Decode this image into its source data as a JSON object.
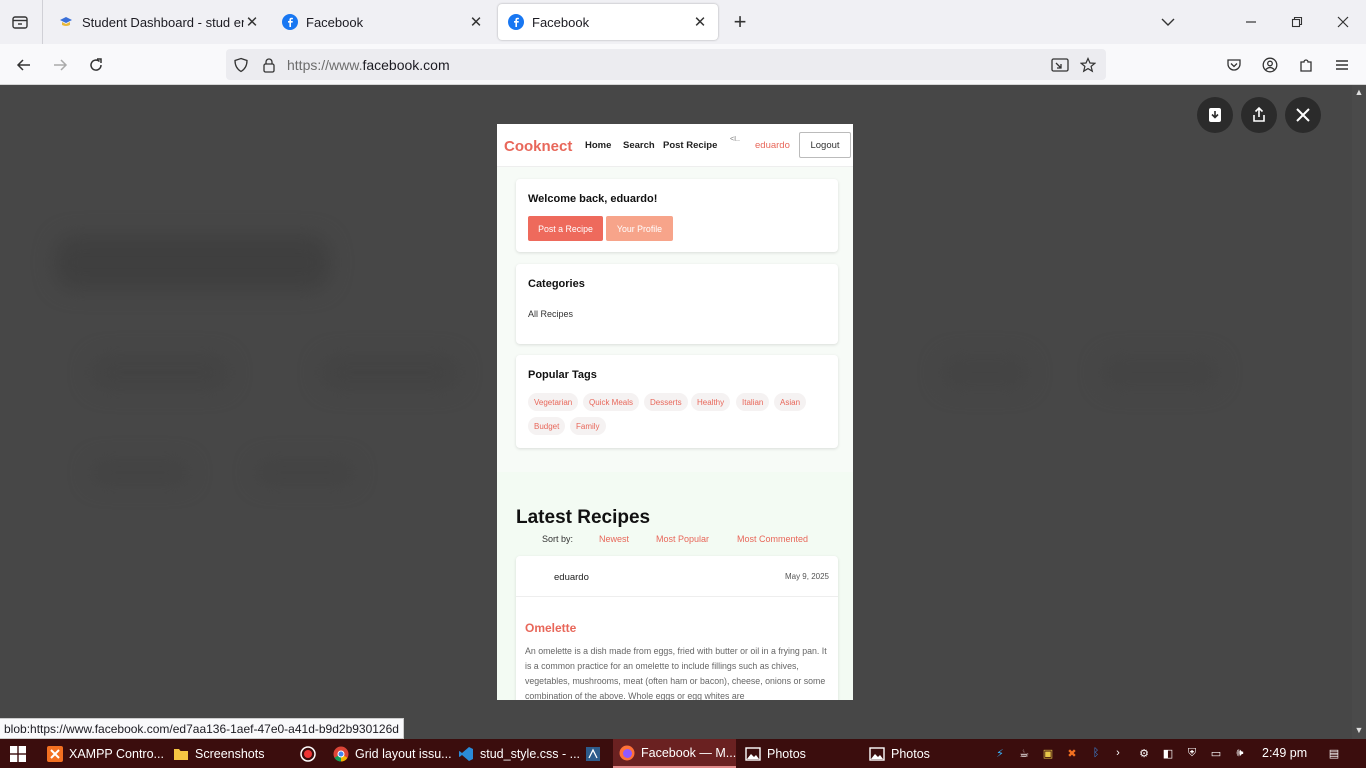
{
  "browser": {
    "tabs": [
      {
        "title": "Student Dashboard - stud ent",
        "active": false
      },
      {
        "title": "Facebook",
        "active": false
      },
      {
        "title": "Facebook",
        "active": true
      }
    ],
    "url_prefix": "https://www.",
    "url_domain": "facebook.com",
    "status_url": "blob:https://www.facebook.com/ed7aa136-1aef-47e0-a41d-b9d2b930126d"
  },
  "cooknect": {
    "logo": "Cooknect",
    "nav": [
      "Home",
      "Search",
      "Post Recipe"
    ],
    "avatar_alt": "<I..",
    "username": "eduardo",
    "logout": "Logout",
    "welcome": "Welcome back, eduardo!",
    "post_btn": "Post a Recipe",
    "profile_btn": "Your Profile",
    "categories_title": "Categories",
    "categories": [
      "All Recipes"
    ],
    "tags_title": "Popular Tags",
    "tags": [
      "Vegetarian",
      "Quick Meals",
      "Desserts",
      "Healthy",
      "Italian",
      "Asian",
      "Budget",
      "Family"
    ],
    "latest_title": "Latest Recipes",
    "sort_label": "Sort by:",
    "sort_options": [
      "Newest",
      "Most Popular",
      "Most Commented"
    ],
    "recipe": {
      "author": "eduardo",
      "date": "May 9, 2025",
      "title": "Omelette",
      "description": "An omelette is a dish made from eggs, fried with butter or oil in a frying pan. It is a common practice for an omelette to include fillings such as chives, vegetables, mushrooms, meat (often ham or bacon), cheese, onions or some combination of the above. Whole eggs or egg whites are"
    }
  },
  "taskbar": {
    "items": [
      {
        "label": "XAMPP Contro...",
        "icon": "xampp-icon"
      },
      {
        "label": "Screenshots",
        "icon": "folder-icon"
      },
      {
        "label": "",
        "icon": "record-icon"
      },
      {
        "label": "Grid layout issu...",
        "icon": "chrome-icon"
      },
      {
        "label": "stud_style.css - ...",
        "icon": "vscode-icon"
      },
      {
        "label": "",
        "icon": "app-icon"
      },
      {
        "label": "Facebook — M...",
        "icon": "firefox-icon"
      },
      {
        "label": "Photos",
        "icon": "photos-icon"
      },
      {
        "label": "Photos",
        "icon": "photos-icon"
      }
    ],
    "clock": "2:49 pm"
  },
  "colors": {
    "accent": "#e8675a",
    "accent_light": "#f7a48a",
    "taskbar": "#3b0d0d",
    "overlay": "#474747"
  }
}
